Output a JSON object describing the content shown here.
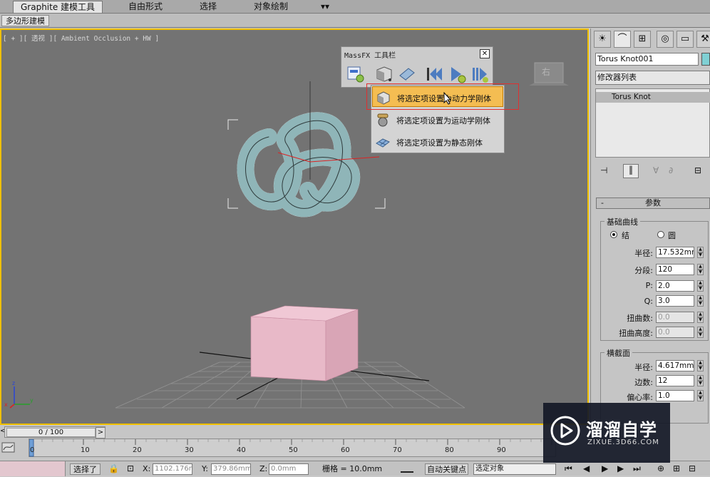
{
  "ribbon": {
    "tabs": [
      "Graphite 建模工具",
      "自由形式",
      "选择",
      "对象绘制"
    ],
    "dropdown": "▾▾",
    "subtab": "多边形建模"
  },
  "viewport": {
    "label": "[ + ][ 透视 ][ Ambient Occlusion + HW ]",
    "viewcube_label": "右",
    "axis": {
      "z": "z",
      "x": "x",
      "y": "y"
    }
  },
  "massfx": {
    "title": "MassFX 工具栏",
    "close": "✕",
    "menu_items": [
      {
        "label": "将选定项设置为动力学刚体",
        "highlighted": true
      },
      {
        "label": "将选定项设置为运动学刚体",
        "highlighted": false
      },
      {
        "label": "将选定项设置为静态刚体",
        "highlighted": false
      }
    ]
  },
  "panel": {
    "tab_icons": [
      "sun-icon",
      "curve-icon",
      "hierarchy-icon",
      "circle-icon",
      "monitor-icon",
      "hammer-icon"
    ],
    "object_name": "Torus Knot001",
    "object_color": "#7fd0d4",
    "modifier_list": "修改器列表",
    "stack_item": "Torus Knot",
    "rollout_title": "参数",
    "rollout_sign": "-",
    "base_curve": {
      "title": "基础曲线",
      "radio_knot": "结",
      "radio_circle": "圆",
      "radius_label": "半径:",
      "radius": "17.532mm",
      "segments_label": "分段:",
      "segments": "120",
      "p_label": "P:",
      "p": "2.0",
      "q_label": "Q:",
      "q": "3.0",
      "warp_count_label": "扭曲数:",
      "warp_count": "0.0",
      "warp_height_label": "扭曲高度:",
      "warp_height": "0.0"
    },
    "cross_section": {
      "title": "横截面",
      "radius_label": "半径:",
      "radius": "4.617mm",
      "sides_label": "边数:",
      "sides": "12",
      "eccentricity_label": "偏心率:",
      "eccentricity": "1.0"
    }
  },
  "timeline": {
    "slider": "0 / 100",
    "prev": "<",
    "next": ">",
    "ticks": [
      "0",
      "10",
      "20",
      "30",
      "40",
      "50",
      "60",
      "70",
      "80",
      "90"
    ]
  },
  "status": {
    "selected": "选择了",
    "x_label": "X:",
    "x": "1102.176m",
    "y_label": "Y:",
    "y": "379.86mm",
    "z_label": "Z:",
    "z": "0.0mm",
    "grid": "栅格 = 10.0mm",
    "auto_key": "自动关键点",
    "select_mode": "选定对象"
  },
  "watermark": {
    "name": "溜溜自学",
    "url": "ZIXUE.3D66.COM"
  },
  "colors": {
    "viewport_bg": "#737373",
    "highlight": "#f4bd52",
    "selection_border": "#e03030",
    "box": "#e8b9c8"
  }
}
